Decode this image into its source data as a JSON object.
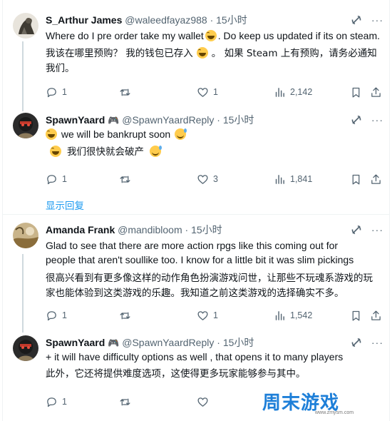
{
  "tweets": [
    {
      "name": "S_Arthur James",
      "handle": "@waleedfayaz988",
      "time": "15小时",
      "text_en": "Where do I pre order take my wallet",
      "text_en2": ". Do keep us updated if its on steam.",
      "text_cn": "我该在哪里预购？ 我的钱包已存入",
      "text_cn2": "。 如果 Steam 上有预购，请务必通知我们。",
      "replies": "1",
      "retweets": "",
      "likes": "1",
      "views": "2,142"
    },
    {
      "name": "SpawnYaard",
      "badge": "🎮",
      "handle": "@SpawnYaardReply",
      "time": "15小时",
      "text_en": "we will be bankrupt soon",
      "text_cn": "我们很快就会破产",
      "replies": "1",
      "retweets": "",
      "likes": "3",
      "views": "1,841"
    },
    {
      "name": "Amanda Frank",
      "handle": "@mandibloom",
      "time": "15小时",
      "text_en": "Glad to see that there are more action rpgs like this coming out for people that aren't soullike too. I know for a little bit it was slim pickings",
      "text_cn": "很高兴看到有更多像这样的动作角色扮演游戏问世，让那些不玩魂系游戏的玩家也能体验到这类游戏的乐趣。我知道之前这类游戏的选择确实不多。",
      "replies": "1",
      "retweets": "",
      "likes": "1",
      "views": "1,542"
    },
    {
      "name": "SpawnYaard",
      "badge": "🎮",
      "handle": "@SpawnYaardReply",
      "time": "15小时",
      "text_en": "+ it will have difficulty options as well , that opens it to many players",
      "text_cn": "此外，它还将提供难度选项，这使得更多玩家能够参与其中。",
      "replies": "1",
      "retweets": "",
      "likes": "",
      "views": ""
    }
  ],
  "show_replies_label": "显示回复",
  "dot": "·",
  "more_glyph": "···",
  "watermark": {
    "text": "周末游戏",
    "url": "www.zmysm.com"
  },
  "colors": {
    "link": "#1d9bf0",
    "secondary": "#536471",
    "border": "#eff3f4"
  }
}
